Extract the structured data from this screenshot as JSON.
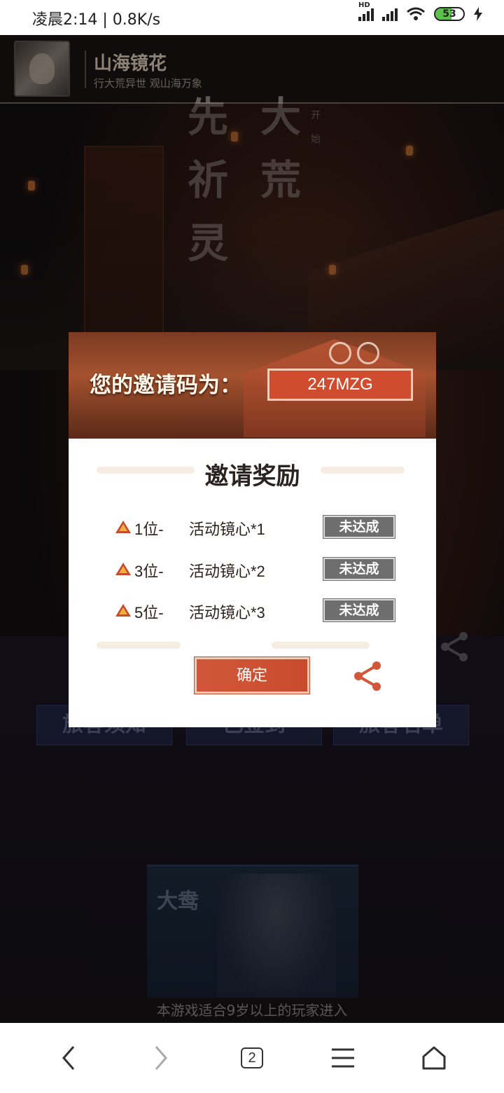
{
  "status_bar": {
    "time_speed": "凌晨2:14 | 0.8K/s",
    "signal_tag": "HD",
    "battery": "53"
  },
  "header": {
    "title": "山海镜花",
    "subtitle": "行大荒异世 观山海万象"
  },
  "background": {
    "banner_chars": [
      "先",
      "大",
      "祈",
      "荒",
      "灵"
    ],
    "vertical_small": [
      "开",
      "始"
    ],
    "buttons": [
      "旅客须知",
      "已签到",
      "旅客名单"
    ],
    "card_name": "大鸯",
    "age_notice": "本游戏适合9岁以上的玩家进入"
  },
  "modal": {
    "code_label": "您的邀请码为：",
    "invite_code": "247MZG",
    "title": "邀请奖励",
    "rewards": [
      {
        "rank": "1位-",
        "item": "活动镜心*1",
        "status": "未达成"
      },
      {
        "rank": "3位-",
        "item": "活动镜心*2",
        "status": "未达成"
      },
      {
        "rank": "5位-",
        "item": "活动镜心*3",
        "status": "未达成"
      }
    ],
    "confirm_label": "确定"
  },
  "nav": {
    "tab_count": "2",
    "icons": [
      "back-icon",
      "forward-icon",
      "tabs-icon",
      "menu-icon",
      "home-icon"
    ]
  },
  "colors": {
    "accent": "#cf4d2e",
    "status_gray": "#6e6e6e",
    "header_bg": "#0f0c0b"
  }
}
